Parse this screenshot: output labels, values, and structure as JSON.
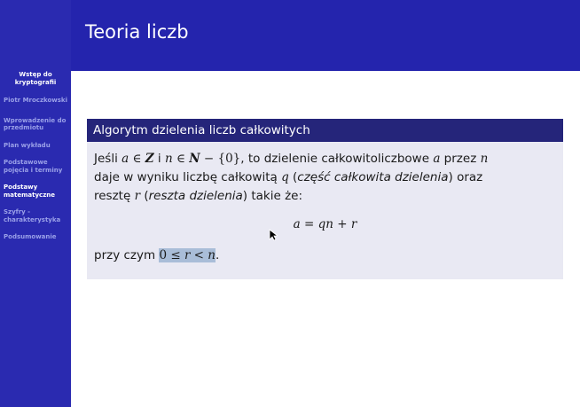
{
  "sidebar": {
    "presentation_title": "Wstęp do kryptografii",
    "author": "Piotr Mroczkowski",
    "items": [
      {
        "label": "Wprowadzenie do przedmiotu",
        "active": false
      },
      {
        "label": "Plan wykładu",
        "active": false
      },
      {
        "label": "Podstawowe pojęcia i terminy",
        "active": false
      },
      {
        "label": "Podstawy matematyczne",
        "active": true
      },
      {
        "label": "Szyfry - charakterystyka",
        "active": false
      },
      {
        "label": "Podsumowanie",
        "active": false
      }
    ]
  },
  "header": {
    "title": "Teoria liczb"
  },
  "block": {
    "title": "Algorytm dzielenia liczb całkowitych",
    "line1_a": "Jeśli ",
    "var_a": "a",
    "in1": " ∈ ",
    "set_Z": "Z",
    "and_i": " i ",
    "var_n": "n",
    "in2": " ∈ ",
    "set_N": "N",
    "minus_zero": " − {0}",
    "line1_b": ", to dzielenie całkowitoliczbowe ",
    "var_a2": "a",
    "przez": " przez ",
    "var_n2": "n",
    "line2_a": "daje w wyniku liczbę całkowitą ",
    "var_q": "q",
    "paren_open": " (",
    "q_desc": "część całkowita dzielenia",
    "paren_close": ") oraz",
    "line3_a": "resztę ",
    "var_r": "r",
    "paren_open2": " (",
    "r_desc": "reszta dzielenia",
    "line3_b": ") takie że:",
    "formula": "a = qn + r",
    "line4_a": "przy czym ",
    "cond_zero": "0",
    "cond_leq": " ≤ ",
    "cond_rest": "r < n",
    "cond_end": "."
  },
  "colors": {
    "sidebar_bg": "#2a2ab0",
    "header_bg": "#2424ad",
    "block_header_bg": "#25257a",
    "block_body_bg": "#e9e9f3",
    "highlight": "#a9bdd8"
  }
}
